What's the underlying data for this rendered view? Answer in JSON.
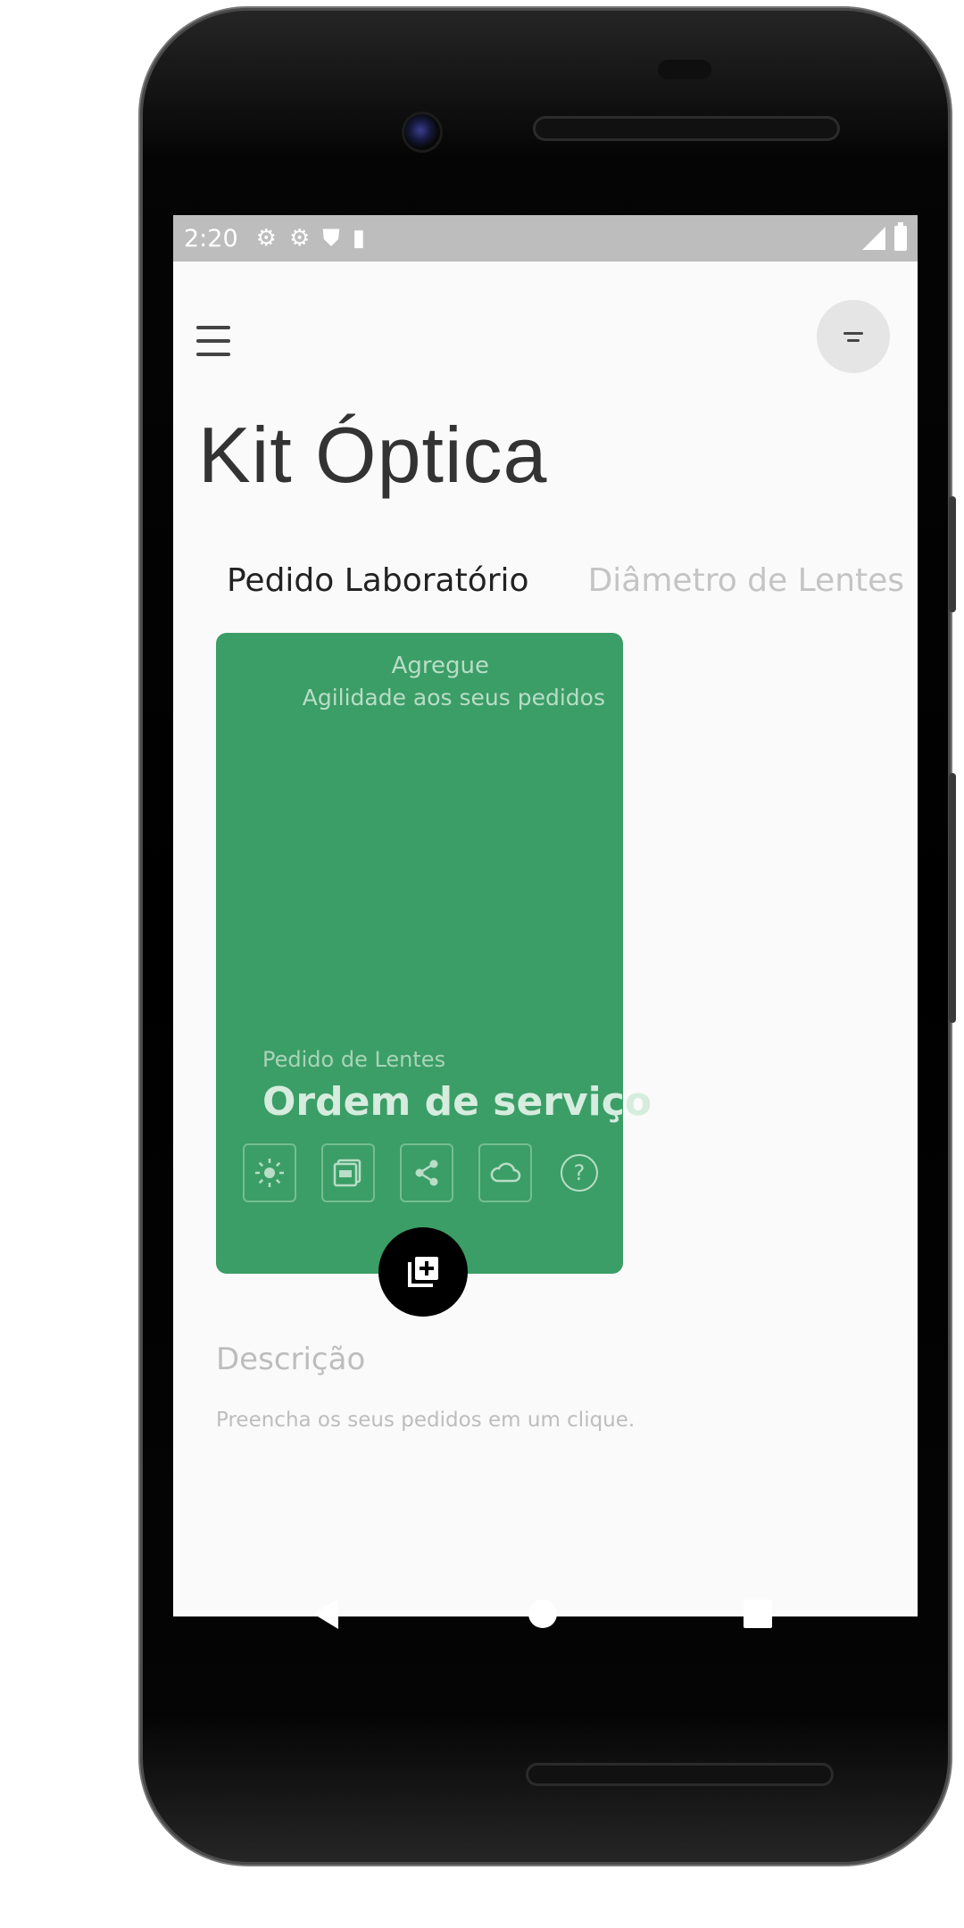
{
  "status_bar": {
    "time": "2:20",
    "icons": [
      "gear-icon",
      "gear-icon",
      "shield-icon",
      "sd-card-icon"
    ],
    "right_icons": [
      "signal-icon",
      "battery-icon"
    ]
  },
  "header": {
    "menu_icon": "hamburger-menu-icon",
    "filter_icon": "filter-icon"
  },
  "app": {
    "title": "Kit Óptica"
  },
  "tabs": [
    {
      "label": "Pedido Laboratório",
      "active": true
    },
    {
      "label": "Diâmetro de Lentes",
      "active": false
    }
  ],
  "card": {
    "color": "#3b9e66",
    "tagline_1": "Agregue",
    "tagline_2": "Agilidade aos seus pedidos",
    "subtitle": "Pedido de Lentes",
    "title": "Ordem de serviço",
    "actions": [
      "brightness-icon",
      "pdf-icon",
      "share-icon",
      "cloud-icon",
      "help-icon"
    ],
    "help_glyph": "?"
  },
  "fab": {
    "icon": "add-to-library-icon"
  },
  "description": {
    "title": "Descrição",
    "text": "Preencha os seus pedidos em um clique."
  },
  "navigation": [
    "back-icon",
    "home-icon",
    "recents-icon"
  ]
}
